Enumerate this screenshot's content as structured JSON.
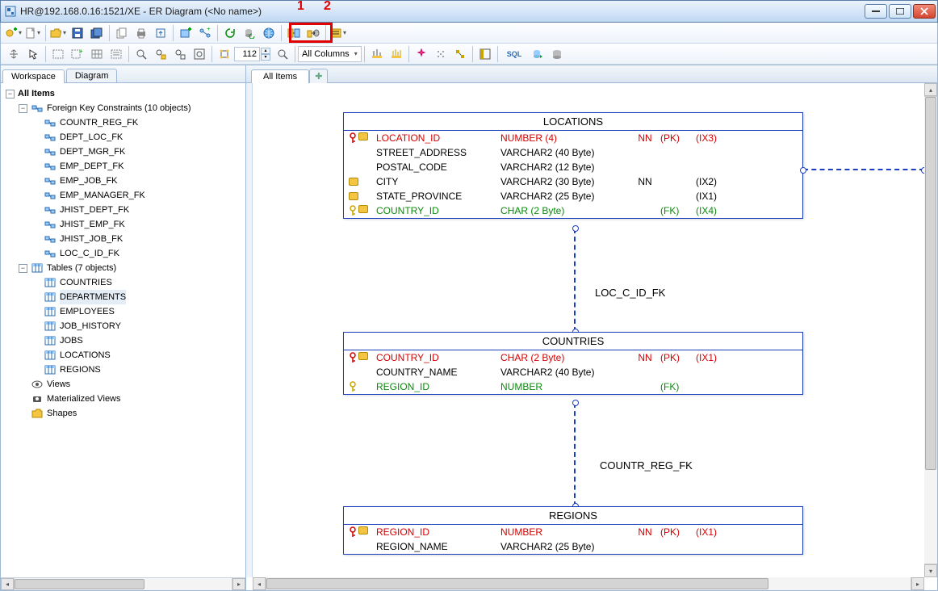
{
  "title": "HR@192.168.0.16:1521/XE - ER Diagram (<No name>)",
  "annotations": {
    "one": "1",
    "two": "2"
  },
  "toolbar": {
    "zoom_value": "112",
    "all_columns": "All Columns"
  },
  "sidebar": {
    "tabs": {
      "workspace": "Workspace",
      "diagram": "Diagram"
    },
    "root": "All Items",
    "fk_header": "Foreign Key Constraints  (10 objects)",
    "fk": [
      "COUNTR_REG_FK",
      "DEPT_LOC_FK",
      "DEPT_MGR_FK",
      "EMP_DEPT_FK",
      "EMP_JOB_FK",
      "EMP_MANAGER_FK",
      "JHIST_DEPT_FK",
      "JHIST_EMP_FK",
      "JHIST_JOB_FK",
      "LOC_C_ID_FK"
    ],
    "tables_header": "Tables  (7 objects)",
    "tables": [
      "COUNTRIES",
      "DEPARTMENTS",
      "EMPLOYEES",
      "JOB_HISTORY",
      "JOBS",
      "LOCATIONS",
      "REGIONS"
    ],
    "views": "Views",
    "mviews": "Materialized Views",
    "shapes": "Shapes"
  },
  "canvas": {
    "tab": "All Items",
    "tables": {
      "locations": {
        "title": "LOCATIONS",
        "rows": [
          {
            "name": "LOCATION_ID",
            "type": "NUMBER (4)",
            "nn": "NN",
            "pk": "(PK)",
            "ix": "(IX3)",
            "cls": "red",
            "key": "pk",
            "chip": true
          },
          {
            "name": "STREET_ADDRESS",
            "type": "VARCHAR2 (40 Byte)",
            "nn": "",
            "pk": "",
            "ix": "",
            "cls": "",
            "key": "",
            "chip": false
          },
          {
            "name": "POSTAL_CODE",
            "type": "VARCHAR2 (12 Byte)",
            "nn": "",
            "pk": "",
            "ix": "",
            "cls": "",
            "key": "",
            "chip": false
          },
          {
            "name": "CITY",
            "type": "VARCHAR2 (30 Byte)",
            "nn": "NN",
            "pk": "",
            "ix": "(IX2)",
            "cls": "",
            "key": "",
            "chip": true
          },
          {
            "name": "STATE_PROVINCE",
            "type": "VARCHAR2 (25 Byte)",
            "nn": "",
            "pk": "",
            "ix": "(IX1)",
            "cls": "",
            "key": "",
            "chip": true
          },
          {
            "name": "COUNTRY_ID",
            "type": "CHAR (2 Byte)",
            "nn": "",
            "pk": "(FK)",
            "ix": "(IX4)",
            "cls": "green",
            "key": "fk",
            "chip": true
          }
        ]
      },
      "countries": {
        "title": "COUNTRIES",
        "rows": [
          {
            "name": "COUNTRY_ID",
            "type": "CHAR (2 Byte)",
            "nn": "NN",
            "pk": "(PK)",
            "ix": "(IX1)",
            "cls": "red",
            "key": "pk",
            "chip": true
          },
          {
            "name": "COUNTRY_NAME",
            "type": "VARCHAR2 (40 Byte)",
            "nn": "",
            "pk": "",
            "ix": "",
            "cls": "",
            "key": "",
            "chip": false
          },
          {
            "name": "REGION_ID",
            "type": "NUMBER",
            "nn": "",
            "pk": "(FK)",
            "ix": "",
            "cls": "green",
            "key": "fk",
            "chip": false
          }
        ]
      },
      "regions": {
        "title": "REGIONS",
        "rows": [
          {
            "name": "REGION_ID",
            "type": "NUMBER",
            "nn": "NN",
            "pk": "(PK)",
            "ix": "(IX1)",
            "cls": "red",
            "key": "pk",
            "chip": true
          },
          {
            "name": "REGION_NAME",
            "type": "VARCHAR2 (25 Byte)",
            "nn": "",
            "pk": "",
            "ix": "",
            "cls": "",
            "key": "",
            "chip": false
          }
        ]
      }
    },
    "fk_labels": {
      "loc_c": "LOC_C_ID_FK",
      "countr_reg": "COUNTR_REG_FK"
    }
  }
}
